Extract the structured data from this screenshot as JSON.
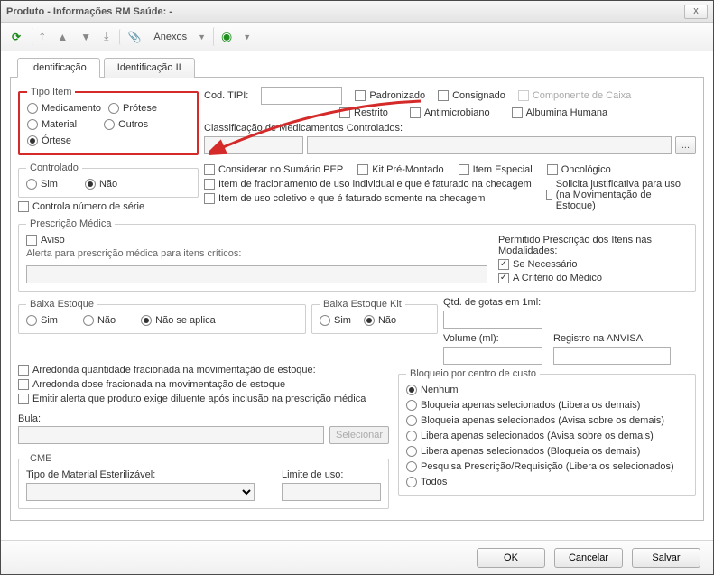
{
  "window": {
    "title": "Produto - Informações RM Saúde:  -"
  },
  "toolbar": {
    "anexos_label": "Anexos"
  },
  "tabs": {
    "identificacao": "Identificação",
    "identificacao2": "Identificação II"
  },
  "tipo_item": {
    "legend": "Tipo Item",
    "medicamento": "Medicamento",
    "protese": "Prótese",
    "material": "Material",
    "outros": "Outros",
    "ortese": "Órtese",
    "selected": "ortese"
  },
  "cod_tipi": {
    "label": "Cod. TIPI:",
    "value": ""
  },
  "flags1": {
    "padronizado": "Padronizado",
    "consignado": "Consignado",
    "componente_caixa": "Componente de Caixa",
    "restrito": "Restrito",
    "antimicrobiano": "Antimicrobiano",
    "albumina": "Albumina Humana"
  },
  "class_med": {
    "label": "Classificação de Medicamentos Controlados:",
    "v1": "",
    "v2": "",
    "pick": "..."
  },
  "controlado": {
    "legend": "Controlado",
    "sim": "Sim",
    "nao": "Não",
    "selected": "nao",
    "controla_numero_serie": "Controla número de série"
  },
  "flags2": {
    "sumario_pep": "Considerar no Sumário PEP",
    "kit_premontado": "Kit Pré-Montado",
    "item_especial": "Item Especial",
    "oncologico": "Oncológico",
    "fracionamento": "Item de fracionamento de uso individual e que é faturado na checagem",
    "coletivo": "Item de uso coletivo e que é faturado somente na checagem",
    "solicita_justificativa": "Solicita justificativa para uso (na Movimentação de Estoque)"
  },
  "prescricao": {
    "legend": "Prescrição Médica",
    "aviso": "Aviso",
    "alerta_label": "Alerta para prescrição médica para itens críticos:",
    "permitido_label": "Permitido Prescrição dos Itens nas Modalidades:",
    "se_necessario": "Se Necessário",
    "criterio_medico": "A Critério do Médico"
  },
  "baixa_estoque": {
    "legend": "Baixa Estoque",
    "sim": "Sim",
    "nao": "Não",
    "na": "Não se aplica",
    "selected": "na"
  },
  "baixa_estoque_kit": {
    "legend": "Baixa Estoque Kit",
    "sim": "Sim",
    "nao": "Não",
    "selected": "nao"
  },
  "medidas": {
    "gotas_label": "Qtd. de gotas em 1ml:",
    "volume_label": "Volume (ml):",
    "anvisa_label": "Registro na ANVISA:",
    "gotas": "",
    "volume": "",
    "anvisa": ""
  },
  "flags3": {
    "arredonda_qtd": "Arredonda quantidade fracionada na movimentação de estoque:",
    "arredonda_dose": "Arredonda dose fracionada na movimentação de estoque",
    "emitir_alerta": "Emitir alerta que produto exige diluente após inclusão na prescrição médica"
  },
  "bula": {
    "label": "Bula:",
    "value": "",
    "selecionar": "Selecionar"
  },
  "bloqueio": {
    "legend": "Bloqueio por centro de custo",
    "nenhum": "Nenhum",
    "b1": "Bloqueia apenas selecionados (Libera os demais)",
    "b2": "Bloqueia apenas selecionados (Avisa sobre os demais)",
    "b3": "Libera apenas selecionados (Avisa sobre os demais)",
    "b4": "Libera apenas selecionados (Bloqueia os demais)",
    "b5": "Pesquisa Prescrição/Requisição (Libera os selecionados)",
    "todos": "Todos",
    "selected": "nenhum"
  },
  "cme": {
    "legend": "CME",
    "tipo_label": "Tipo de Material Esterilizável:",
    "limite_label": "Limite de uso:",
    "tipo": "",
    "limite": ""
  },
  "footer": {
    "ok": "OK",
    "cancelar": "Cancelar",
    "salvar": "Salvar"
  }
}
